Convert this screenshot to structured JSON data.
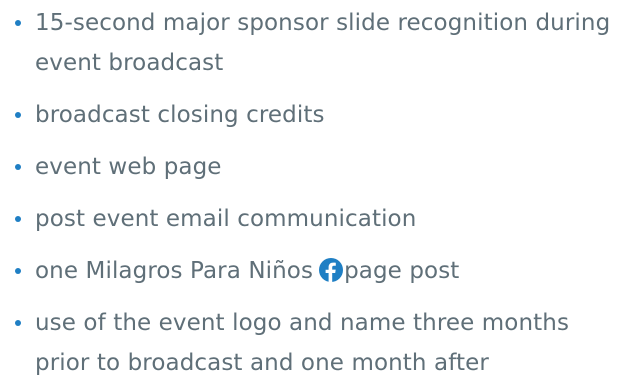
{
  "colors": {
    "text": "#5f6f78",
    "bullet": "#1f7fc4",
    "facebook_blue": "#1f7fc4"
  },
  "benefits": [
    {
      "text": "15-second major sponsor slide recognition during event broadcast"
    },
    {
      "text": "broadcast closing credits"
    },
    {
      "text": "event web page"
    },
    {
      "text": "post event email communication"
    },
    {
      "text_before": "one Milagros Para Niños",
      "icon": "facebook-icon",
      "text_after": "page post"
    },
    {
      "text": "use of the event logo and name three months prior to broadcast and one month after"
    }
  ]
}
